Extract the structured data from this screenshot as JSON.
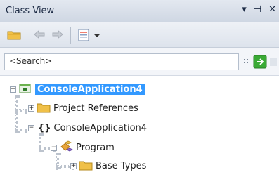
{
  "window": {
    "title": "Class View",
    "buttons": [
      "▾",
      "⊣",
      "✕"
    ]
  },
  "toolbar": {
    "icons": [
      "folder-icon",
      "back-arrow-icon",
      "forward-arrow-icon",
      "settings-icon",
      "chevron-down-icon"
    ]
  },
  "search": {
    "placeholder": "<Search>",
    "value": "<Search>"
  },
  "tree": {
    "root": {
      "label": "ConsoleApplication4",
      "expanded": true,
      "selected": true
    },
    "children": [
      {
        "label": "Project References",
        "expanded": false
      },
      {
        "label": "ConsoleApplication4",
        "expanded": true,
        "icon": "{}"
      },
      {
        "label": "Program",
        "expanded": true
      },
      {
        "label": "Base Types",
        "expanded": false
      }
    ]
  },
  "colors": {
    "selection": "#3399ff",
    "folder": "#f0c048",
    "title_bg": "#d6dde8"
  }
}
